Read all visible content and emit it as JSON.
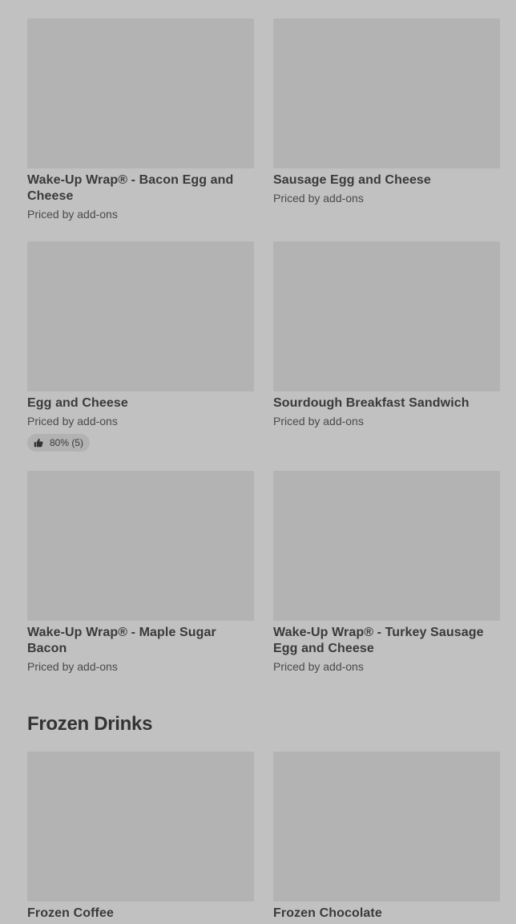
{
  "items": [
    {
      "title": "Wake-Up Wrap® - Bacon Egg and Cheese",
      "price": "Priced by add-ons"
    },
    {
      "title": "Sausage Egg and Cheese",
      "price": "Priced by add-ons"
    },
    {
      "title": "Egg and Cheese",
      "price": "Priced by add-ons",
      "rating": "80% (5)"
    },
    {
      "title": "Sourdough Breakfast Sandwich",
      "price": "Priced by add-ons"
    },
    {
      "title": "Wake-Up Wrap® - Maple Sugar Bacon",
      "price": "Priced by add-ons"
    },
    {
      "title": "Wake-Up Wrap® - Turkey Sausage Egg and Cheese",
      "price": "Priced by add-ons"
    }
  ],
  "section": {
    "title": "Frozen Drinks",
    "items": [
      {
        "title": "Frozen Coffee"
      },
      {
        "title": "Frozen Chocolate"
      }
    ]
  },
  "icons": {
    "rating": "thumbs-up-icon"
  },
  "colors": {
    "background": "#c1c1c1",
    "image_placeholder": "#b3b3b3",
    "text": "#333333"
  }
}
